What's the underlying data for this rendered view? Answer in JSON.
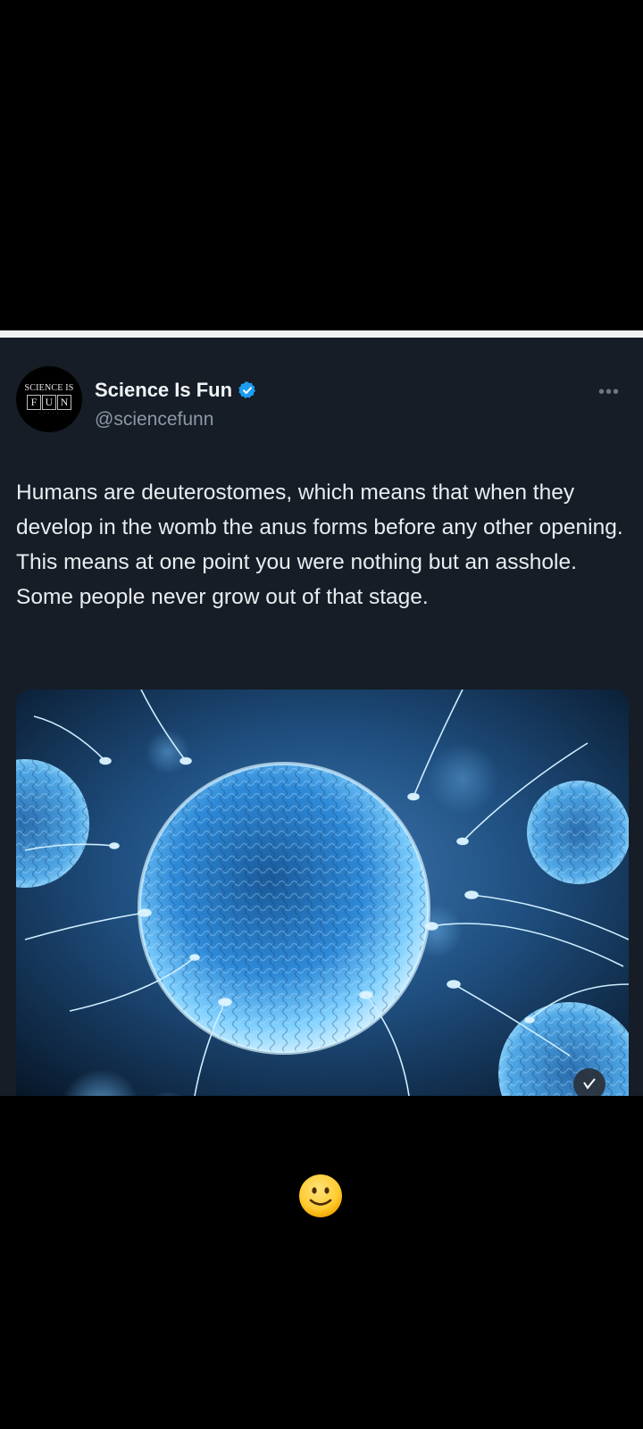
{
  "tweet": {
    "author_name": "Science Is Fun",
    "author_handle": "@sciencefunn",
    "text": "Humans are deuterostomes, which means that when they develop in the womb the anus forms before any other opening. This means at one point you were nothing but an asshole. Some people never grow out of that stage.",
    "more_label": "•••",
    "avatar": {
      "line1": "SCIENCE IS",
      "letters": [
        "F",
        "U",
        "N"
      ]
    }
  },
  "icons": {
    "verified": "verified-badge-icon",
    "emoji": "slightly-smiling-face-icon"
  },
  "colors": {
    "tweet_bg": "#161d26",
    "verified_blue": "#1d9bf0",
    "handle_gray": "#8b98a5"
  }
}
